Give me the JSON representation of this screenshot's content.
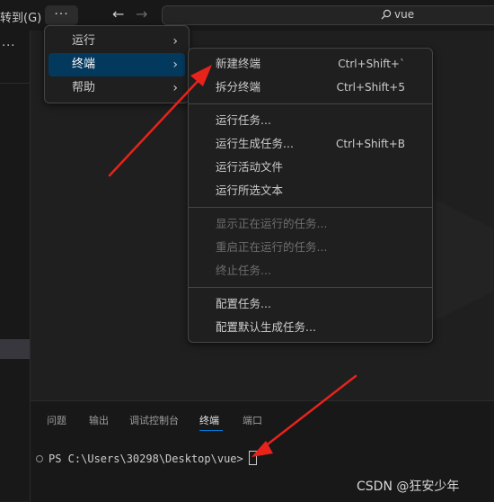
{
  "titlebar": {
    "menu_goto": "转到(G)",
    "more": "···",
    "back_glyph": "←",
    "forward_glyph": "→",
    "search_text": "vue"
  },
  "sidebar": {
    "dots": "···"
  },
  "menu": {
    "items": [
      {
        "label": "运行",
        "chevron": "›"
      },
      {
        "label": "终端",
        "chevron": "›",
        "active": true
      },
      {
        "label": "帮助",
        "chevron": "›"
      }
    ]
  },
  "terminal_menu": {
    "new_terminal": {
      "label": "新建终端",
      "key": "Ctrl+Shift+`"
    },
    "split_terminal": {
      "label": "拆分终端",
      "key": "Ctrl+Shift+5"
    },
    "run_task": {
      "label": "运行任务..."
    },
    "run_build_task": {
      "label": "运行生成任务...",
      "key": "Ctrl+Shift+B"
    },
    "run_active_file": {
      "label": "运行活动文件"
    },
    "run_selected_text": {
      "label": "运行所选文本"
    },
    "show_running_tasks": {
      "label": "显示正在运行的任务..."
    },
    "restart_running_task": {
      "label": "重启正在运行的任务..."
    },
    "terminate_task": {
      "label": "终止任务..."
    },
    "configure_tasks": {
      "label": "配置任务..."
    },
    "configure_default_build": {
      "label": "配置默认生成任务..."
    }
  },
  "panel": {
    "tabs": [
      "问题",
      "输出",
      "调试控制台",
      "终端",
      "端口"
    ],
    "active_tab": "终端",
    "prompt": "PS C:\\Users\\30298\\Desktop\\vue>"
  },
  "watermark": "CSDN @狂安少年",
  "colors": {
    "accent": "#0078d4",
    "menu_highlight": "#04395e",
    "arrow": "#e8231b"
  }
}
